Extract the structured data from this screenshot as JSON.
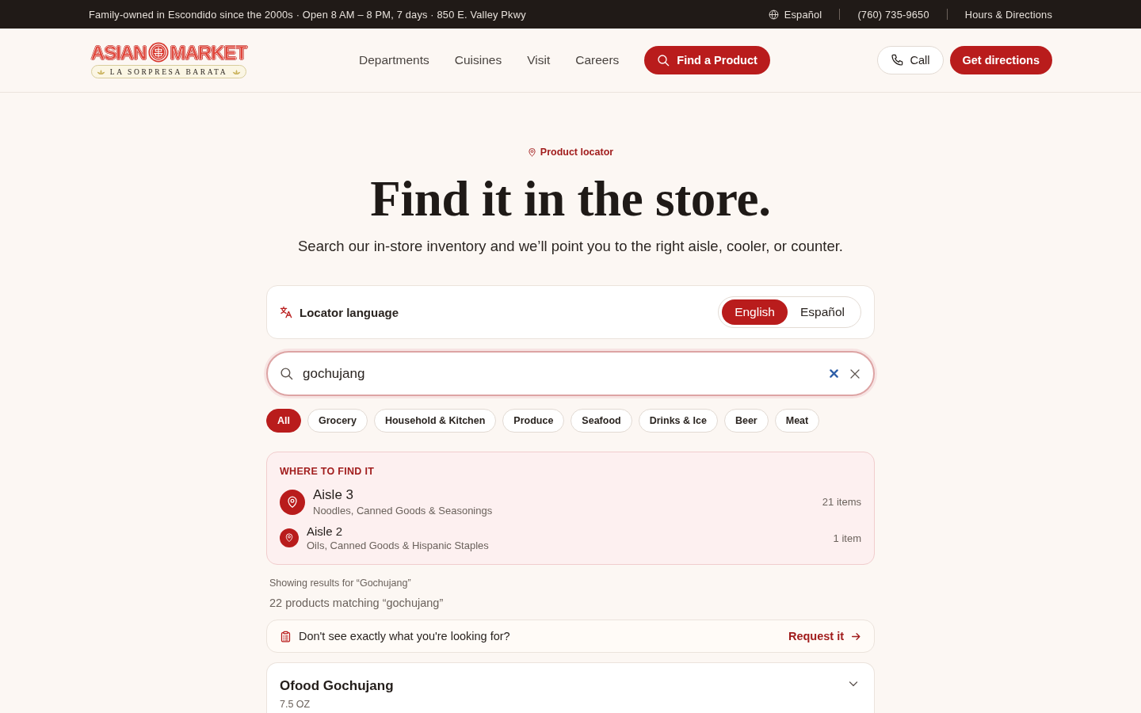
{
  "top_bar": {
    "tagline": "Family-owned in Escondido since the 2000s · Open 8 AM – 8 PM, 7 days · 850 E. Valley Pkwy",
    "language_link": "Español",
    "phone": "(760) 735-9650",
    "hours_link": "Hours & Directions"
  },
  "header": {
    "logo": {
      "word_left": "ASIAN",
      "word_right": "MARKET",
      "tagline": "LA SORPRESA BARATA"
    },
    "nav": [
      "Departments",
      "Cuisines",
      "Visit",
      "Careers"
    ],
    "find_button": "Find a Product",
    "call_button": "Call",
    "directions_button": "Get directions"
  },
  "hero": {
    "eyebrow": "Product locator",
    "title": "Find it in the store.",
    "subtitle": "Search our in-store inventory and we’ll point you to the right aisle, cooler, or counter."
  },
  "language_card": {
    "label": "Locator language",
    "options": [
      {
        "label": "English",
        "selected": true
      },
      {
        "label": "Español",
        "selected": false
      }
    ]
  },
  "search": {
    "value": "gochujang"
  },
  "filters": [
    {
      "label": "All",
      "selected": true
    },
    {
      "label": "Grocery",
      "selected": false
    },
    {
      "label": "Household & Kitchen",
      "selected": false
    },
    {
      "label": "Produce",
      "selected": false
    },
    {
      "label": "Seafood",
      "selected": false
    },
    {
      "label": "Drinks & Ice",
      "selected": false
    },
    {
      "label": "Beer",
      "selected": false
    },
    {
      "label": "Meat",
      "selected": false
    }
  ],
  "locations": {
    "title": "WHERE TO FIND IT",
    "items": [
      {
        "kind": "primary",
        "name": "Aisle 3",
        "sections": "Noodles, Canned Goods & Seasonings",
        "count": "21 items"
      },
      {
        "kind": "secondary",
        "name": "Aisle 2",
        "sections": "Oils, Canned Goods & Hispanic Staples",
        "count": "1 item"
      }
    ]
  },
  "results": {
    "showing": "Showing results for “Gochujang”",
    "count": "22 products matching “gochujang”"
  },
  "request_bar": {
    "text": "Don't see exactly what you're looking for?",
    "link": "Request it"
  },
  "products": [
    {
      "name": "Ofood Gochujang",
      "size": "7.5 OZ",
      "expanded": false
    }
  ]
}
